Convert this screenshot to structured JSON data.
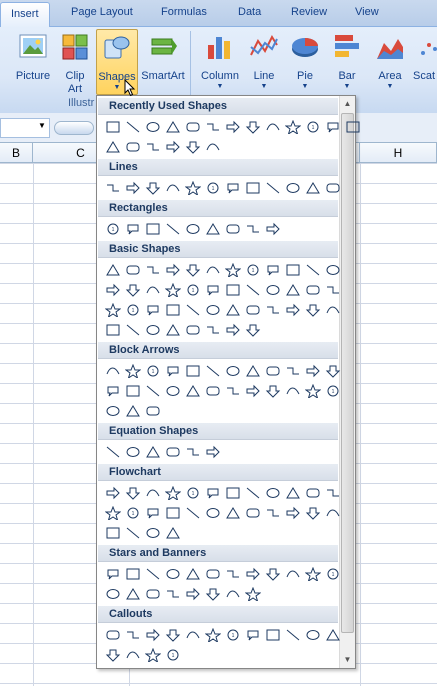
{
  "tabs": [
    {
      "label": "Insert",
      "active": true
    },
    {
      "label": "Page Layout"
    },
    {
      "label": "Formulas"
    },
    {
      "label": "Data"
    },
    {
      "label": "Review"
    },
    {
      "label": "View"
    }
  ],
  "ribbon": {
    "picture": "Picture",
    "clipart_1": "Clip",
    "clipart_2": "Art",
    "shapes": "Shapes",
    "smartart": "SmartArt",
    "column": "Column",
    "line": "Line",
    "pie": "Pie",
    "bar": "Bar",
    "area": "Area",
    "scatter": "Scat",
    "group_illustrations": "Illustr"
  },
  "columns": [
    "B",
    "C",
    "H"
  ],
  "dropdown": {
    "sections": [
      {
        "title": "Recently Used Shapes",
        "rows": [
          13,
          6
        ]
      },
      {
        "title": "Lines",
        "rows": [
          12
        ]
      },
      {
        "title": "Rectangles",
        "rows": [
          9
        ]
      },
      {
        "title": "Basic Shapes",
        "rows": [
          12,
          12,
          12,
          8
        ]
      },
      {
        "title": "Block Arrows",
        "rows": [
          12,
          12,
          3
        ]
      },
      {
        "title": "Equation Shapes",
        "rows": [
          6
        ]
      },
      {
        "title": "Flowchart",
        "rows": [
          12,
          12,
          4
        ]
      },
      {
        "title": "Stars and Banners",
        "rows": [
          12,
          8
        ]
      },
      {
        "title": "Callouts",
        "rows": [
          12,
          4
        ]
      }
    ]
  },
  "colors": {
    "ribbon_bg": "#dbe7f7",
    "accent": "#15428b",
    "selected": "#ffd35e"
  }
}
